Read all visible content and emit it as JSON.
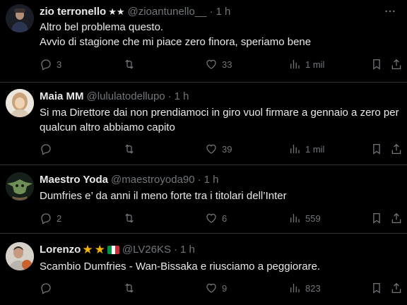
{
  "colors": {
    "background": "#000000",
    "text": "#e7e9ea",
    "muted": "#71767b",
    "divider": "#2f3336",
    "star": "#f6b400"
  },
  "tweets": [
    {
      "name": "zio terronello",
      "badge": "★★",
      "handle": "@zioantunello__",
      "time": "1 h",
      "text": "Altro bel problema questo.\nAvvio di stagione che mi piace zero finora, speriamo bene",
      "replies": "3",
      "retweets": "",
      "likes": "33",
      "views": "1 mil"
    },
    {
      "name": "Maia MM",
      "handle": "@lululatodellupo",
      "time": "1 h",
      "text": "Si ma Direttore dai non prendiamoci in giro vuol firmare a gennaio a zero per qualcun altro abbiamo capito",
      "replies": "",
      "retweets": "",
      "likes": "39",
      "views": "1 mil"
    },
    {
      "name": "Maestro Yoda",
      "handle": "@maestroyoda90",
      "time": "1 h",
      "text": "Dumfries e’ da anni il meno forte tra i titolari dell’Inter",
      "replies": "2",
      "retweets": "",
      "likes": "6",
      "views": "559"
    },
    {
      "name": "Lorenzo",
      "badge_icons": [
        "star-emoji",
        "star-emoji",
        "italy-flag-emoji"
      ],
      "handle": "@LV26KS",
      "time": "1 h",
      "text": "Scambio Dumfries - Wan-Bissaka e riusciamo a peggiorare.",
      "replies": "",
      "retweets": "",
      "likes": "9",
      "views": "823"
    }
  ],
  "ui": {
    "separator": "·",
    "more_icon": "more-dots-icon"
  }
}
